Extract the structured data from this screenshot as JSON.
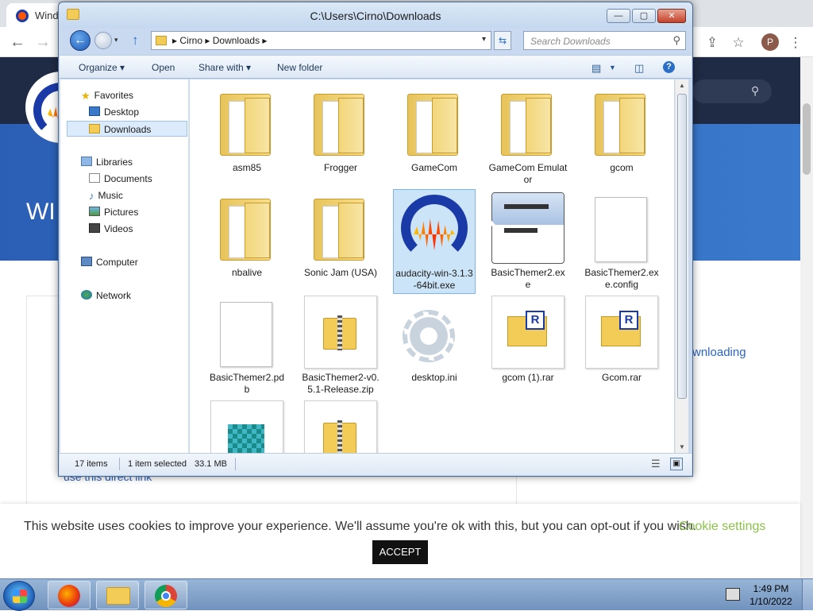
{
  "browser": {
    "tab_title": "Wind",
    "page_hero_text": "WI",
    "page_link_text": "wnloading",
    "page_partial_text": "use this direct link",
    "profile_initial": "P"
  },
  "cookie": {
    "message": "This website uses cookies to improve your experience. We'll assume you're ok with this, but you can opt-out if you wish.",
    "settings_label": "Cookie settings",
    "accept_label": "ACCEPT"
  },
  "explorer": {
    "title": "C:\\Users\\Cirno\\Downloads",
    "breadcrumb": "▸ Cirno ▸ Downloads ▸",
    "search_placeholder": "Search Downloads",
    "toolbar": {
      "organize": "Organize ▾",
      "open": "Open",
      "share_with": "Share with ▾",
      "new_folder": "New folder"
    },
    "nav": {
      "favorites": "Favorites",
      "desktop": "Desktop",
      "downloads": "Downloads",
      "libraries": "Libraries",
      "documents": "Documents",
      "music": "Music",
      "pictures": "Pictures",
      "videos": "Videos",
      "computer": "Computer",
      "network": "Network"
    },
    "files": [
      {
        "name": "asm85",
        "type": "folder"
      },
      {
        "name": "Frogger",
        "type": "folder"
      },
      {
        "name": "GameCom",
        "type": "folder"
      },
      {
        "name": "GameCom Emulator",
        "type": "folder"
      },
      {
        "name": "gcom",
        "type": "folder"
      },
      {
        "name": "nbalive",
        "type": "folder"
      },
      {
        "name": "Sonic Jam (USA)",
        "type": "folder"
      },
      {
        "name": "audacity-win-3.1.3-64bit.exe",
        "type": "audacity"
      },
      {
        "name": "BasicThemer2.exe",
        "type": "exe"
      },
      {
        "name": "BasicThemer2.exe.config",
        "type": "blank"
      },
      {
        "name": "BasicThemer2.pdb",
        "type": "blank"
      },
      {
        "name": "BasicThemer2-v0.5.1-Release.zip",
        "type": "zip"
      },
      {
        "name": "desktop.ini",
        "type": "ini"
      },
      {
        "name": "gcom (1).rar",
        "type": "rar"
      },
      {
        "name": "Gcom.rar",
        "type": "rar"
      },
      {
        "name": "",
        "type": "reg"
      },
      {
        "name": "",
        "type": "zip"
      }
    ],
    "status": {
      "count": "17 items",
      "selection": "1 item selected",
      "size": "33.1 MB"
    }
  },
  "taskbar": {
    "time": "1:49 PM",
    "date": "1/10/2022"
  }
}
